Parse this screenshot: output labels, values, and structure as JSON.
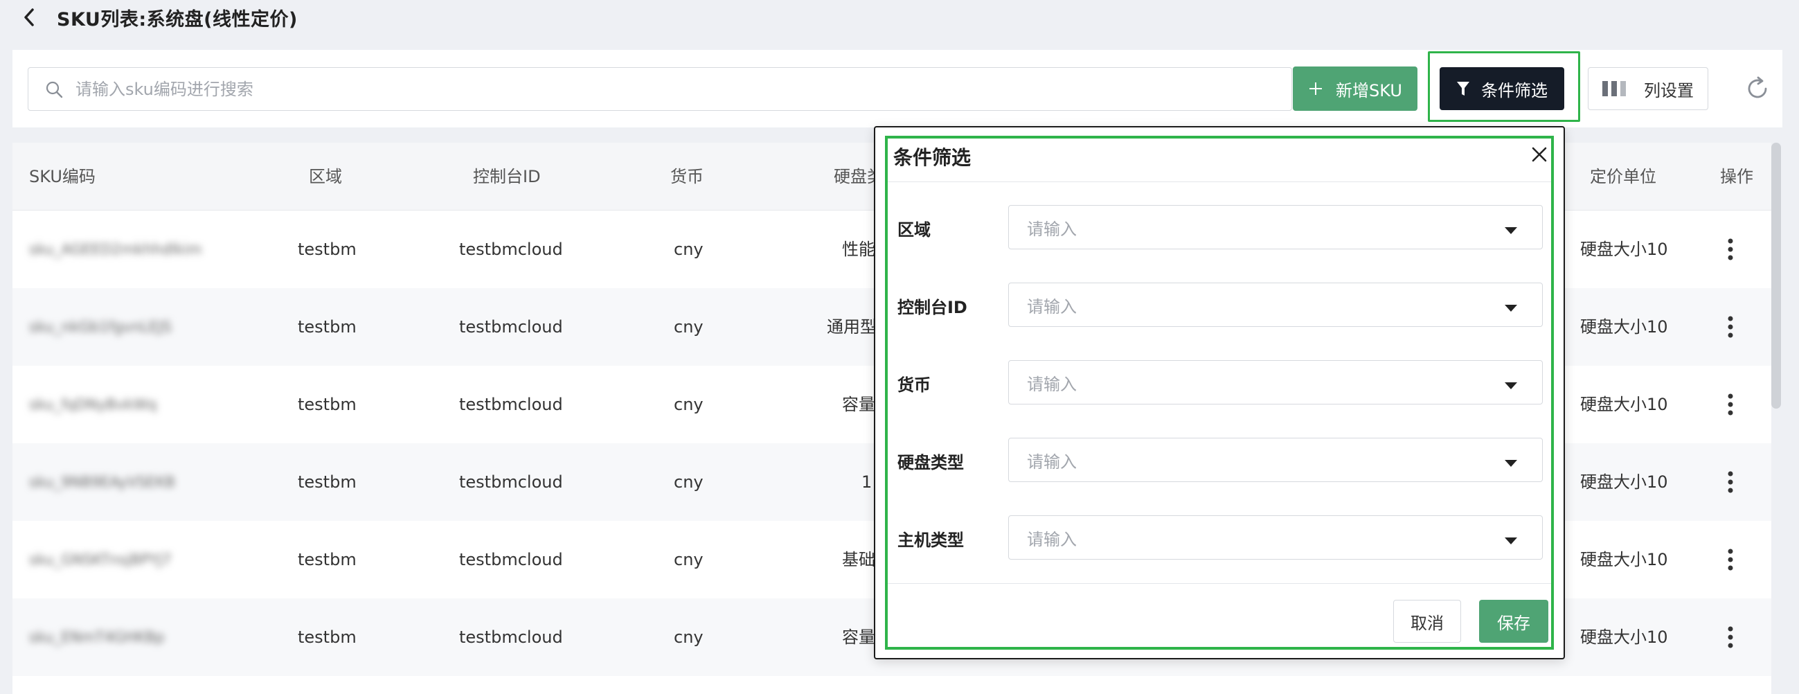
{
  "header": {
    "title": "SKU列表:系统盘(线性定价)"
  },
  "toolbar": {
    "search_placeholder": "请输入sku编码进行搜索",
    "add_label": "新增SKU",
    "filter_label": "条件筛选",
    "columns_label": "列设置"
  },
  "table": {
    "headers": {
      "sku": "SKU编码",
      "region": "区域",
      "console": "控制台ID",
      "currency": "货币",
      "disk": "硬盘类",
      "unit": "定价单位",
      "ops": "操作"
    },
    "rows": [
      {
        "sku": "sku_AGEED2mkhhdlkim",
        "region": "testbm",
        "console": "testbmcloud",
        "currency": "cny",
        "disk": "性能",
        "unit": "硬盘大小10"
      },
      {
        "sku": "sku_nkGb1fgvnLEJS",
        "region": "testbm",
        "console": "testbmcloud",
        "currency": "cny",
        "disk": "通用型",
        "unit": "硬盘大小10"
      },
      {
        "sku": "sku_fqDNyBvkWq",
        "region": "testbm",
        "console": "testbmcloud",
        "currency": "cny",
        "disk": "容量",
        "unit": "硬盘大小10"
      },
      {
        "sku": "sku_9NB9EAyVSEKB",
        "region": "testbm",
        "console": "testbmcloud",
        "currency": "cny",
        "disk": "1",
        "unit": "硬盘大小10"
      },
      {
        "sku": "sku_GNSKTnsjBPYJ7",
        "region": "testbm",
        "console": "testbmcloud",
        "currency": "cny",
        "disk": "基础",
        "unit": "硬盘大小10"
      },
      {
        "sku": "sku_ENmT4GHKBp",
        "region": "testbm",
        "console": "testbmcloud",
        "currency": "cny",
        "disk": "容量",
        "unit": "硬盘大小10"
      }
    ]
  },
  "dialog": {
    "title": "条件筛选",
    "fields": [
      {
        "label": "区域",
        "placeholder": "请输入"
      },
      {
        "label": "控制台ID",
        "placeholder": "请输入"
      },
      {
        "label": "货币",
        "placeholder": "请输入"
      },
      {
        "label": "硬盘类型",
        "placeholder": "请输入"
      },
      {
        "label": "主机类型",
        "placeholder": "请输入"
      }
    ],
    "cancel_label": "取消",
    "save_label": "保存"
  },
  "colors": {
    "primary_green": "#4fa474",
    "dark_button": "#151c28",
    "highlight_green": "#2fb44a"
  }
}
